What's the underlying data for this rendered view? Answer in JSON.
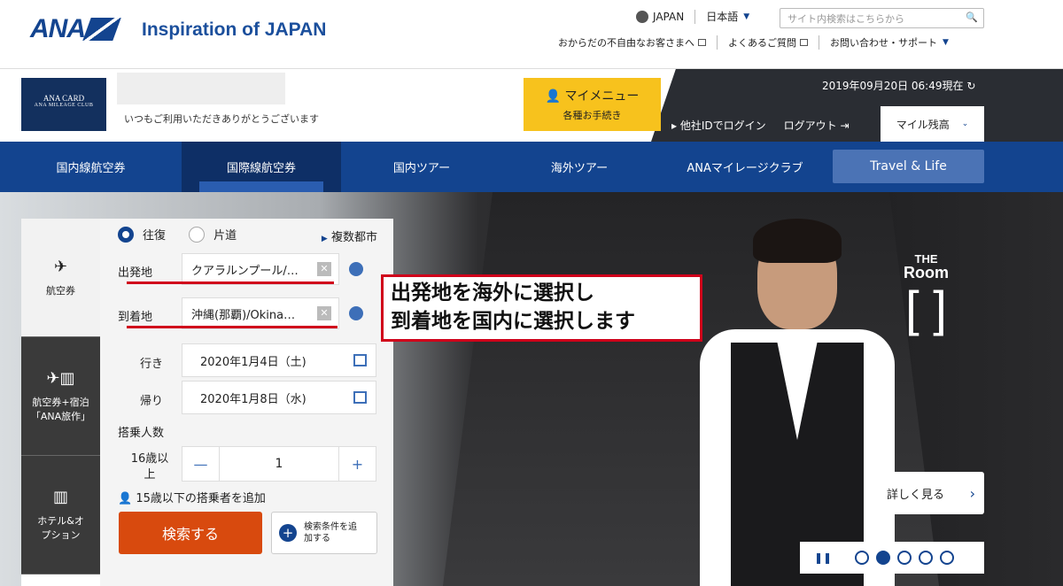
{
  "header": {
    "logo": "ANA",
    "tagline": "Inspiration of JAPAN",
    "region": "JAPAN",
    "language": "日本語",
    "search_placeholder": "サイト内検索はこちらから",
    "links": [
      "おからだの不自由なお客さまへ",
      "よくあるご質問",
      "お問い合わせ・サポート"
    ]
  },
  "member": {
    "card_line1": "ANA CARD",
    "card_line2": "ANA MILEAGE CLUB",
    "welcome": "いつもご利用いただきありがとうございます",
    "mymenu_title": "マイメニュー",
    "mymenu_sub": "各種お手続き",
    "datetime": "2019年09月20日 06:49現在",
    "other_login": "他社IDでログイン",
    "logout": "ログアウト",
    "miles": "マイル残高"
  },
  "nav": [
    "国内線航空券",
    "国際線航空券",
    "国内ツアー",
    "海外ツアー",
    "ANAマイレージクラブ",
    "Travel & Life"
  ],
  "booking": {
    "tabs": [
      "航空券",
      "航空券+宿泊「ANA旅作」",
      "ホテル&オプション"
    ],
    "trip_types": [
      "往復",
      "片道"
    ],
    "multi_city": "複数都市",
    "from_label": "出発地",
    "from_value": "クアラルンプール/…",
    "to_label": "到着地",
    "to_value": "沖縄(那覇)/Okina…",
    "depart_label": "行き",
    "depart_value": "2020年1月4日（土)",
    "return_label": "帰り",
    "return_value": "2020年1月8日（水)",
    "passengers_label": "搭乗人数",
    "adult_label": "16歳以上",
    "adult_count": "1",
    "minus": "—",
    "plus": "+",
    "add_child": "15歳以下の搭乗者を追加",
    "search_button": "検索する",
    "options_button": "検索条件を追加する"
  },
  "hero": {
    "room_title_1": "THE",
    "room_title_2": "Room",
    "room_bracket": "[ ]",
    "more_button": "詳しく見る"
  },
  "annotation": [
    "出発地を海外に選択し",
    "到着地を国内に選択します"
  ]
}
